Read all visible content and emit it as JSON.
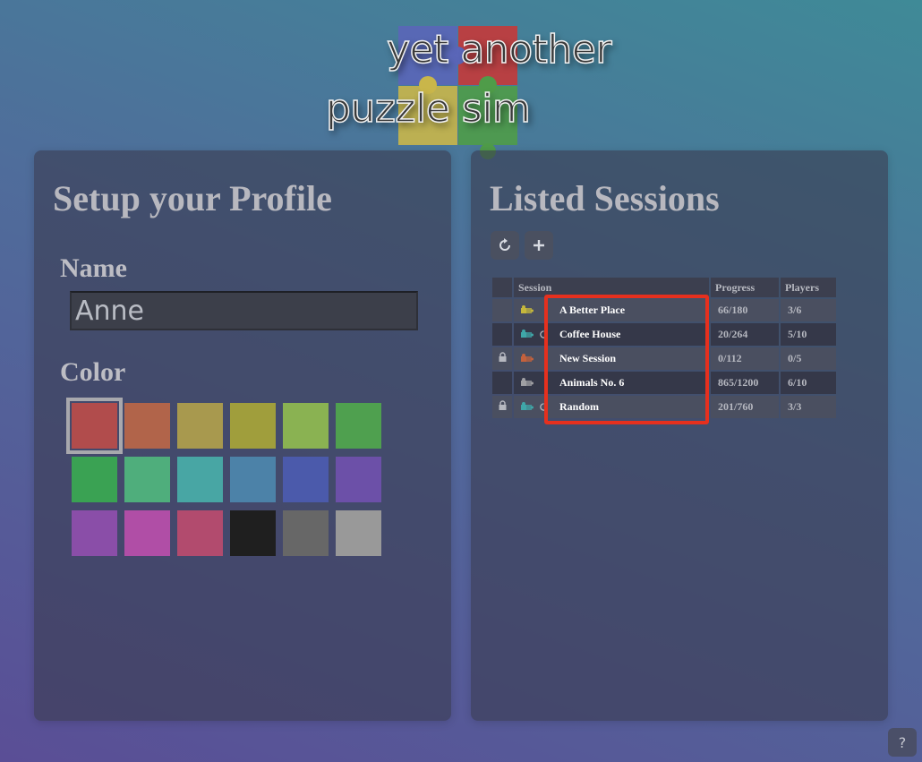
{
  "logo": {
    "line1": "yet another",
    "line2": "puzzle sim",
    "piece_colors": [
      "#5a66b8",
      "#c43a3a",
      "#c9b64a",
      "#4f9c49"
    ]
  },
  "profile": {
    "title": "Setup your Profile",
    "name_label": "Name",
    "name_value": "Anne",
    "color_label": "Color",
    "selected_color_index": 0,
    "colors": [
      "#b14c4c",
      "#b1644a",
      "#a8994e",
      "#a09e3c",
      "#8ab252",
      "#4fa04f",
      "#3aa253",
      "#4fae7c",
      "#48a6a4",
      "#4c82a8",
      "#4b5aab",
      "#6c50a8",
      "#8a4ea8",
      "#b04ea6",
      "#b24b6e",
      "#1f1f1f",
      "#676767",
      "#999999"
    ]
  },
  "sessions": {
    "title": "Listed Sessions",
    "refresh_icon": "refresh-icon",
    "add_icon": "plus-icon",
    "headers": {
      "session": "Session",
      "progress": "Progress",
      "players": "Players"
    },
    "rows": [
      {
        "name": "A Better Place",
        "progress": "66/180",
        "players": "3/6",
        "locked": false,
        "spinning": false,
        "icon_color": "#c6b83c"
      },
      {
        "name": "Coffee House",
        "progress": "20/264",
        "players": "5/10",
        "locked": false,
        "spinning": true,
        "icon_color": "#3fa6a8"
      },
      {
        "name": "New Session",
        "progress": "0/112",
        "players": "0/5",
        "locked": true,
        "spinning": false,
        "icon_color": "#c4613c"
      },
      {
        "name": "Animals No. 6",
        "progress": "865/1200",
        "players": "6/10",
        "locked": false,
        "spinning": false,
        "icon_color": "#a0a0a4"
      },
      {
        "name": "Random",
        "progress": "201/760",
        "players": "3/3",
        "locked": true,
        "spinning": true,
        "icon_color": "#3fa6a8"
      }
    ]
  },
  "help": {
    "label": "?"
  }
}
